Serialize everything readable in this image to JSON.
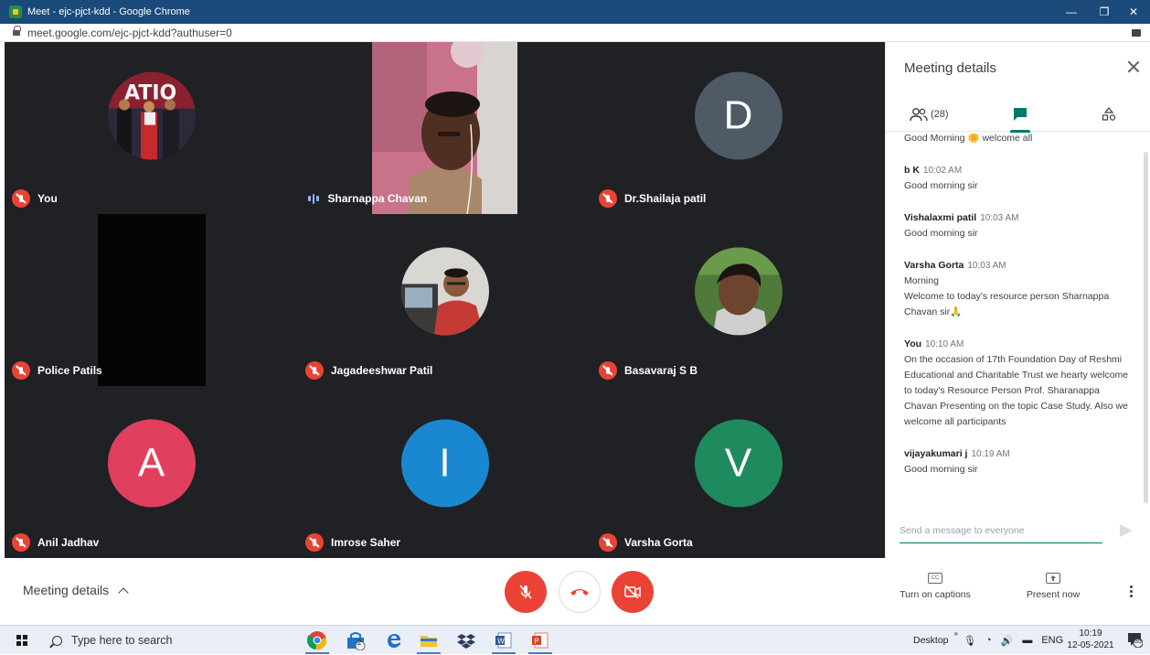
{
  "browser": {
    "title": "Meet - ejc-pjct-kdd - Google Chrome",
    "url": "meet.google.com/ejc-pjct-kdd?authuser=0"
  },
  "tiles": [
    {
      "name": "You",
      "muted": true
    },
    {
      "name": "Sharnappa Chavan",
      "muted": false,
      "speaking": true
    },
    {
      "name": "Dr.Shailaja patil",
      "muted": true,
      "initial": "D",
      "color": "#4e5b67"
    },
    {
      "name": "Police Patils",
      "muted": true
    },
    {
      "name": "Jagadeeshwar Patil",
      "muted": true
    },
    {
      "name": "Basavaraj S B",
      "muted": true
    },
    {
      "name": "Anil Jadhav",
      "muted": true,
      "initial": "A",
      "color": "#e0405e"
    },
    {
      "name": "Imrose Saher",
      "muted": true,
      "initial": "I",
      "color": "#1a88d0"
    },
    {
      "name": "Varsha Gorta",
      "muted": true,
      "initial": "V",
      "color": "#1f8a5e"
    }
  ],
  "panel": {
    "title": "Meeting details",
    "people_count": "(28)",
    "messages": [
      {
        "sender": "",
        "time": "",
        "lines": [
          "Good Morning 🌼 welcome all"
        ]
      },
      {
        "sender": "b K",
        "time": "10:02 AM",
        "lines": [
          "Good morning sir"
        ]
      },
      {
        "sender": "Vishalaxmi patil",
        "time": "10:03 AM",
        "lines": [
          "Good morning sir"
        ]
      },
      {
        "sender": "Varsha Gorta",
        "time": "10:03 AM",
        "lines": [
          "Morning",
          "Welcome to today's resource person Sharnappa Chavan sir🙏"
        ]
      },
      {
        "sender": "You",
        "time": "10:10 AM",
        "lines": [
          "On the occasion of 17th Foundation Day of Reshmi Educational and Charitable Trust we hearty welcome to today's Resource Person Prof. Sharanappa Chavan Presenting on the topic Case Study. Also we welcome all participants"
        ]
      },
      {
        "sender": "vijayakumari j",
        "time": "10:19 AM",
        "lines": [
          "Good morning sir"
        ]
      }
    ],
    "input_placeholder": "Send a message to everyone"
  },
  "bottom": {
    "details_label": "Meeting details",
    "captions_label": "Turn on captions",
    "present_label": "Present now",
    "captions_icon_text": "CC"
  },
  "taskbar": {
    "search_placeholder": "Type here to search",
    "desktop_label": "Desktop",
    "language": "ENG",
    "time": "10:19",
    "date": "12-05-2021",
    "notifications": "35",
    "store_badge": "2"
  }
}
